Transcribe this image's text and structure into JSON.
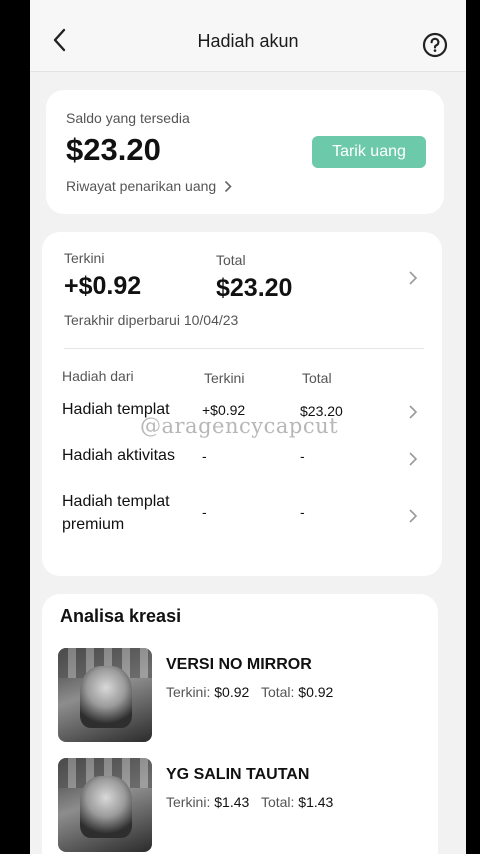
{
  "header": {
    "title": "Hadiah akun"
  },
  "balance_card": {
    "label": "Saldo yang tersedia",
    "amount": "$23.20",
    "withdraw_button": "Tarik uang",
    "history_link": "Riwayat penarikan uang"
  },
  "summary": {
    "latest_label": "Terkini",
    "latest_value": "+$0.92",
    "total_label": "Total",
    "total_value": "$23.20",
    "updated": "Terakhir diperbarui 10/04/23"
  },
  "table": {
    "headers": [
      "Hadiah dari",
      "Terkini",
      "Total"
    ],
    "rows": [
      {
        "name": "Hadiah templat",
        "latest": "+$0.92",
        "total": "$23.20"
      },
      {
        "name": "Hadiah aktivitas",
        "latest": "-",
        "total": "-"
      },
      {
        "name": "Hadiah templat premium",
        "latest": "-",
        "total": "-"
      }
    ]
  },
  "watermark": "@aragencycapcut",
  "analysis": {
    "title": "Analisa kreasi",
    "items": [
      {
        "title": "VERSI NO MIRROR",
        "latest_label": "Terkini:",
        "latest": "$0.92",
        "total_label": "Total:",
        "total": "$0.92"
      },
      {
        "title": "YG SALIN TAUTAN",
        "latest_label": "Terkini:",
        "latest": "$1.43",
        "total_label": "Total:",
        "total": "$1.43"
      }
    ]
  },
  "colors": {
    "accent": "#6ccaaa",
    "background": "#f2f2f2"
  },
  "icons": [
    "back-arrow-icon",
    "help-circle-icon",
    "chevron-right-icon"
  ]
}
